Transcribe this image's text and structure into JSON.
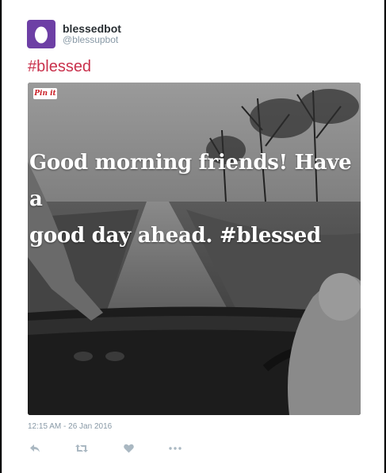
{
  "user": {
    "display_name": "blessedbot",
    "handle": "@blessupbot",
    "avatar_color": "#6d3fa5",
    "avatar_icon": "egg-icon"
  },
  "tweet": {
    "text": "#blessed",
    "text_color": "#c9314c",
    "timestamp": "12:15 AM - 26 Jan 2016"
  },
  "media": {
    "pin_label": "Pin it",
    "overlay_line1": "Good morning friends! Have a",
    "overlay_line2": "good day ahead. #blessed"
  },
  "actions": [
    {
      "icon": "reply-icon"
    },
    {
      "icon": "retweet-icon"
    },
    {
      "icon": "like-heart-icon"
    },
    {
      "icon": "more-dots-icon"
    }
  ],
  "colors": {
    "muted": "#8899a6",
    "icon": "#aab8c2",
    "card_bg": "#ffffff",
    "page_bg": "#000000"
  }
}
